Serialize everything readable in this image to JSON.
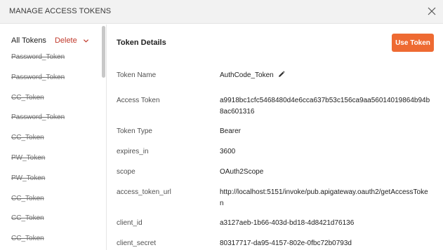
{
  "dialog": {
    "title": "MANAGE ACCESS TOKENS"
  },
  "sidebar": {
    "all_tokens_label": "All Tokens",
    "delete_label": "Delete",
    "tokens": [
      "Password_Token",
      "Password_Token",
      "CC_Token",
      "Password_Token",
      "CC_Token",
      "PW_Token",
      "PW_Token",
      "CC_Token",
      "CC_Token",
      "CC_Token"
    ]
  },
  "details": {
    "section_title": "Token Details",
    "use_token_label": "Use Token",
    "fields": [
      {
        "key": "Token Name",
        "value": "AuthCode_Token"
      },
      {
        "key": "Access Token",
        "value": "a9918bc1cfc5468480d4e6cca637b53c156ca9aa56014019864b94b8ac601316"
      },
      {
        "key": "Token Type",
        "value": "Bearer"
      },
      {
        "key": "expires_in",
        "value": "3600"
      },
      {
        "key": "scope",
        "value": "OAuth2Scope"
      },
      {
        "key": "access_token_url",
        "value": "http://localhost:5151/invoke/pub.apigateway.oauth2/getAccessToken"
      },
      {
        "key": "client_id",
        "value": "a3127aeb-1b66-403d-bd18-4d8421d76136"
      },
      {
        "key": "client_secret",
        "value": "80317717-da95-4157-802e-0fbc72b0793d"
      }
    ]
  },
  "colors": {
    "accent": "#ee6a32",
    "delete": "#c0392b"
  },
  "icons": {
    "close": "close-icon",
    "chevron": "chevron-down-icon",
    "edit": "pencil-icon"
  }
}
